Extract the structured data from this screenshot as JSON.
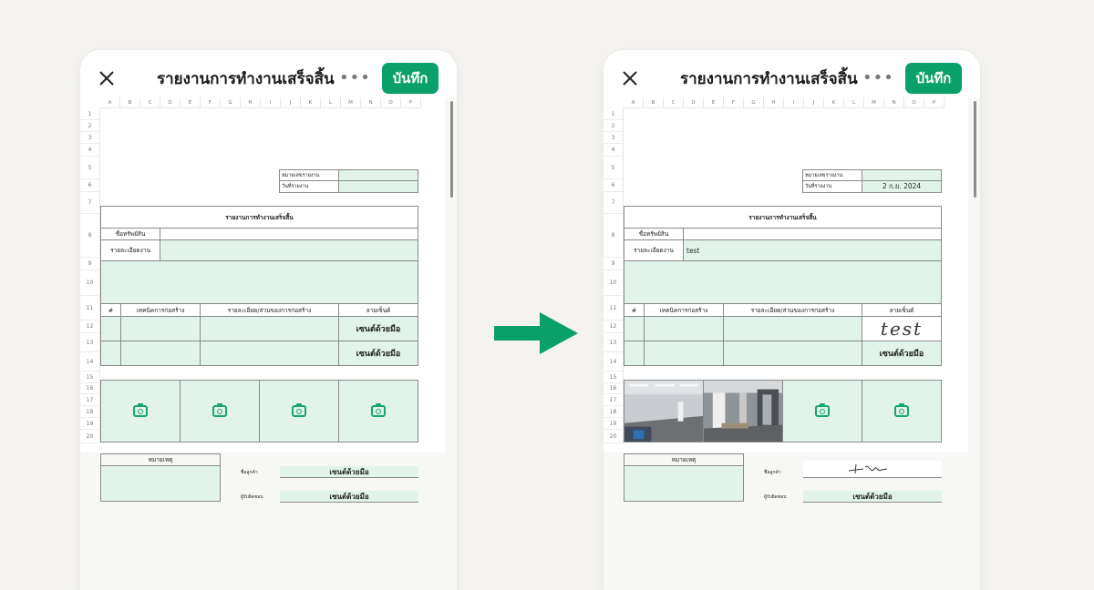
{
  "app": {
    "title": "รายงานการทำงานเสร็จสิ้น",
    "save_label": "บันทึก",
    "more_label": "•••"
  },
  "sheet": {
    "columns": [
      "A",
      "B",
      "C",
      "D",
      "E",
      "F",
      "G",
      "H",
      "I",
      "J",
      "K",
      "L",
      "M",
      "N",
      "O",
      "P"
    ],
    "rows": [
      "1",
      "2",
      "3",
      "4",
      "5",
      "6",
      "7",
      "8",
      "9",
      "10",
      "11",
      "12",
      "13",
      "14",
      "15",
      "16",
      "17",
      "18",
      "19",
      "20"
    ],
    "report_no_label": "หมายเลขรายงาน",
    "report_date_label": "วันที่รายงาน",
    "heading": "รายงานการทำงานเสร็จสิ้น",
    "asset_name_label": "ชื่อทรัพย์สิน",
    "work_detail_label": "รายละเอียดงาน",
    "table_header_no": "#",
    "table_header_technique": "เทคนิคการก่อสร้าง",
    "table_header_detail": "รายละเอียด/ส่วนของการก่อสร้าง",
    "table_header_signature": "ลายเซ็นต์",
    "sign_by_hand": "เซนต์ด้วยมือ",
    "remarks_label": "หมายเหตุ",
    "customer_name_label": "ชื่อลูกค้า",
    "recipient_label": "ผู้รับผิดชอบ"
  },
  "left": {
    "row10_signature": "เซนต์ด้วยมือ",
    "row11_signature": "เซนต์ด้วยมือ",
    "customer_signature": "เซนต์ด้วยมือ",
    "recipient_signature": "เซนต์ด้วยมือ"
  },
  "right": {
    "report_date_value": "2 ก.ย. 2024",
    "work_detail_value": "test",
    "row10_signature": "test",
    "row11_signature": "เซนต์ด้วยมือ",
    "recipient_signature": "เซนต์ด้วยมือ"
  },
  "colors": {
    "accent": "#0aa06a",
    "cell_fill": "#e2f4ea",
    "arrow": "#0aa06a"
  },
  "icons": [
    "close-icon",
    "more-icon",
    "camera-icon",
    "arrow-right-icon"
  ]
}
